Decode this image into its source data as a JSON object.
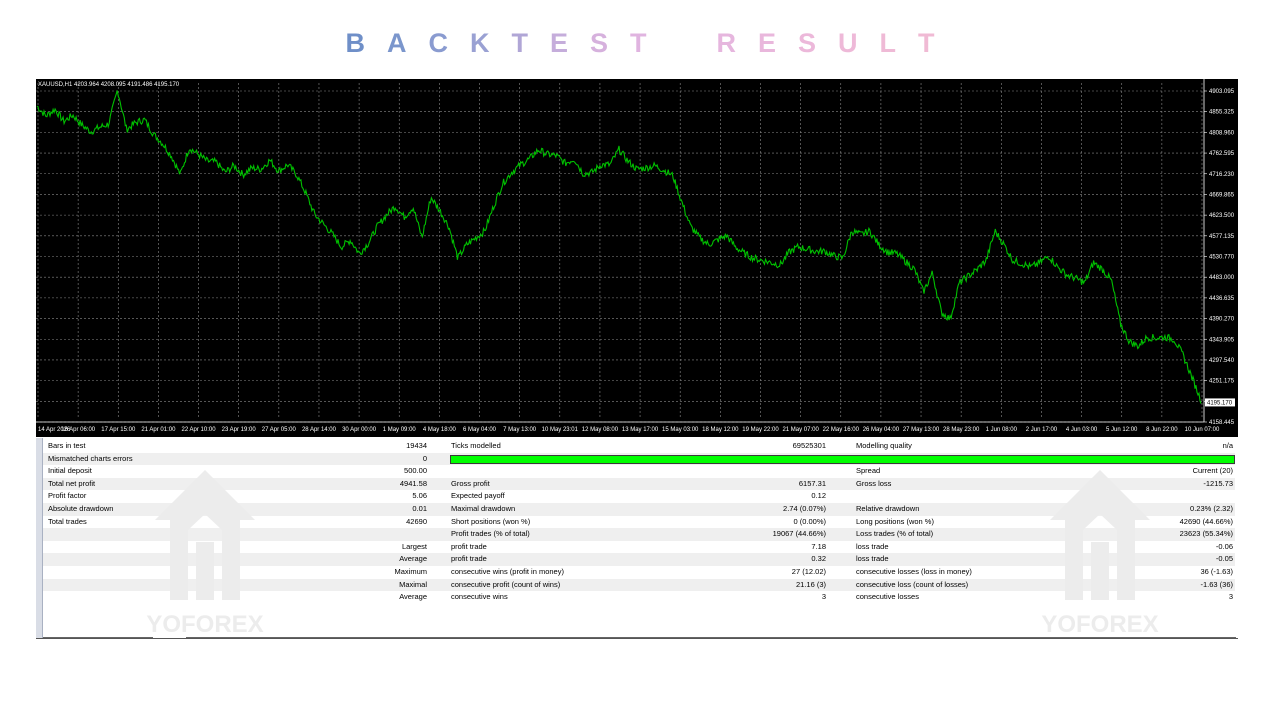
{
  "title": {
    "word1": [
      "B",
      "A",
      "C",
      "K",
      "T",
      "E",
      "S",
      "T"
    ],
    "word2": [
      "R",
      "E",
      "S",
      "U",
      "L",
      "T"
    ],
    "colors": [
      "#6f8fc8",
      "#7b96cc",
      "#8a9bd0",
      "#9aa1d3",
      "#b0a6d6",
      "#c5addb",
      "#d6b1dd",
      "#e0b4e0"
    ],
    "colors2": [
      "#e6b6de",
      "#e9b7dc",
      "#ecb8da",
      "#eeb9d8",
      "#efbad6",
      "#f0bad4"
    ]
  },
  "chart": {
    "symbol": "XAUUSD,H1  4203.964 4208.095 4191.486 4195.170",
    "price_labels": [
      "4903.095",
      "4855.325",
      "4808.960",
      "4762.595",
      "4716.230",
      "4669.865",
      "4623.500",
      "4577.135",
      "4530.770",
      "4483.000",
      "4436.635",
      "4390.270",
      "4343.905",
      "4297.540",
      "4251.175",
      "4204.810",
      "4158.445"
    ],
    "current_price": "4195.170",
    "time_labels": [
      "14 Apr 2026",
      "16 Apr 06:00",
      "17 Apr 15:00",
      "21 Apr 01:00",
      "22 Apr 10:00",
      "23 Apr 19:00",
      "27 Apr 05:00",
      "28 Apr 14:00",
      "30 Apr 00:00",
      "1 May 09:00",
      "4 May 18:00",
      "6 May 04:00",
      "7 May 13:00",
      "10 May 23:01",
      "12 May 08:00",
      "13 May 17:00",
      "15 May 03:00",
      "18 May 12:00",
      "19 May 22:00",
      "21 May 07:00",
      "22 May 16:00",
      "26 May 04:00",
      "27 May 13:00",
      "28 May 23:00",
      "1 Jun 08:00",
      "2 Jun 17:00",
      "4 Jun 03:00",
      "5 Jun 12:00",
      "8 Jun 22:00",
      "10 Jun 07:00"
    ],
    "line_color": "#00c000",
    "grid_color": "#8a8a8a"
  },
  "chart_data": {
    "type": "line",
    "title": "",
    "series": [
      {
        "values": [
          4852,
          4830,
          4845,
          4818,
          4832,
          4810,
          4795,
          4805,
          4812,
          4888,
          4800,
          4815,
          4822,
          4790,
          4770,
          4742,
          4700,
          4760,
          4745,
          4730,
          4728,
          4705,
          4720,
          4700,
          4715,
          4712,
          4732,
          4708,
          4722,
          4700,
          4660,
          4612,
          4590,
          4568,
          4540,
          4555,
          4525,
          4548,
          4585,
          4610,
          4630,
          4606,
          4628,
          4560,
          4650,
          4620,
          4585,
          4515,
          4545,
          4560,
          4575,
          4630,
          4680,
          4705,
          4722,
          4735,
          4755,
          4745,
          4742,
          4725,
          4735,
          4702,
          4705,
          4722,
          4722,
          4756,
          4730,
          4712,
          4715,
          4720,
          4710,
          4698,
          4640,
          4585,
          4560,
          4545,
          4555,
          4565,
          4540,
          4525,
          4515,
          4510,
          4505,
          4500,
          4528,
          4540,
          4535,
          4530,
          4530,
          4520,
          4515,
          4575,
          4567,
          4575,
          4545,
          4528,
          4525,
          4508,
          4490,
          4440,
          4482,
          4395,
          4380,
          4460,
          4475,
          4490,
          4510,
          4575,
          4545,
          4510,
          4503,
          4495,
          4505,
          4520,
          4495,
          4478,
          4470,
          4460,
          4505,
          4490,
          4465,
          4370,
          4330,
          4320,
          4340,
          4338,
          4340,
          4335,
          4300,
          4250,
          4200
        ]
      }
    ],
    "xlabel": "",
    "ylabel": "",
    "ylim": [
      4158.445,
      4903.095
    ],
    "grid": true
  },
  "report": {
    "rows": [
      {
        "c1": "Bars in test",
        "c2": "19434",
        "c3": "Ticks modelled",
        "c4": "69525301",
        "c5": "Modelling quality",
        "c6": "n/a",
        "alt": false
      },
      {
        "c1": "Mismatched charts errors",
        "c2": "0",
        "c3": "",
        "c4": "",
        "c5": "",
        "c6": "",
        "alt": true,
        "bar": true
      },
      {
        "c1": "Initial deposit",
        "c2": "500.00",
        "c3": "",
        "c4": "",
        "c5": "Spread",
        "c6": "Current (20)",
        "alt": false
      },
      {
        "c1": "Total net profit",
        "c2": "4941.58",
        "c3": "Gross profit",
        "c4": "6157.31",
        "c5": "Gross loss",
        "c6": "-1215.73",
        "alt": true
      },
      {
        "c1": "Profit factor",
        "c2": "5.06",
        "c3": "Expected payoff",
        "c4": "0.12",
        "c5": "",
        "c6": "",
        "alt": false
      },
      {
        "c1": "Absolute drawdown",
        "c2": "0.01",
        "c3": "Maximal drawdown",
        "c4": "2.74 (0.07%)",
        "c5": "Relative drawdown",
        "c6": "0.23% (2.32)",
        "alt": true
      },
      {
        "c1": "Total trades",
        "c2": "42690",
        "c3": "Short positions (won %)",
        "c4": "0 (0.00%)",
        "c5": "Long positions (won %)",
        "c6": "42690 (44.66%)",
        "alt": false
      },
      {
        "c1": "",
        "c2": "",
        "c3": "Profit trades (% of total)",
        "c4": "19067 (44.66%)",
        "c5": "Loss trades (% of total)",
        "c6": "23623 (55.34%)",
        "alt": true
      },
      {
        "c1": "",
        "c2": "Largest",
        "c3": "profit trade",
        "c4": "7.18",
        "c5": "loss trade",
        "c6": "-0.06",
        "alt": false
      },
      {
        "c1": "",
        "c2": "Average",
        "c3": "profit trade",
        "c4": "0.32",
        "c5": "loss trade",
        "c6": "-0.05",
        "alt": true
      },
      {
        "c1": "",
        "c2": "Maximum",
        "c3": "consecutive wins (profit in money)",
        "c4": "27 (12.02)",
        "c5": "consecutive losses (loss in money)",
        "c6": "36 (-1.63)",
        "alt": false
      },
      {
        "c1": "",
        "c2": "Maximal",
        "c3": "consecutive profit (count of wins)",
        "c4": "21.16 (3)",
        "c5": "consecutive loss (count of losses)",
        "c6": "-1.63 (36)",
        "alt": true
      },
      {
        "c1": "",
        "c2": "Average",
        "c3": "consecutive wins",
        "c4": "3",
        "c5": "consecutive losses",
        "c6": "3",
        "alt": false
      }
    ]
  },
  "watermark": {
    "text": "YOFOREX",
    "color": "#ececec"
  }
}
